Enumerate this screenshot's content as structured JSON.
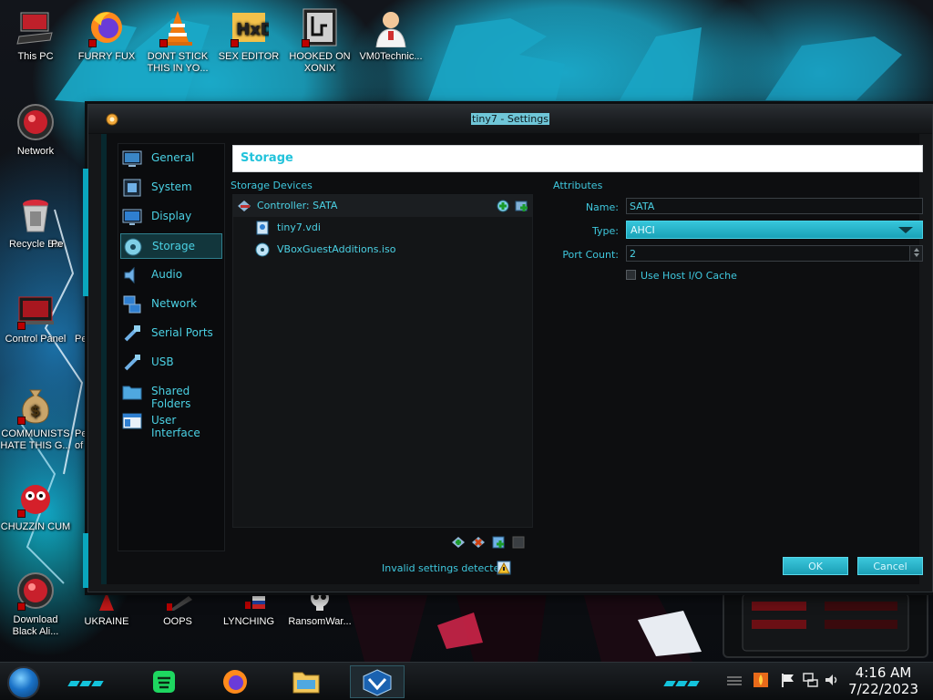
{
  "desktop": {
    "icons": [
      {
        "label": "This PC",
        "icon": "computer-icon"
      },
      {
        "label": "FURRY FUX",
        "icon": "firefox-icon"
      },
      {
        "label": "DONT STICK THIS IN YO...",
        "icon": "vlc-cone-icon"
      },
      {
        "label": "SEX EDITOR",
        "icon": "hxd-icon"
      },
      {
        "label": "HOOKED ON XONIX",
        "icon": "xonix-game-icon"
      },
      {
        "label": "VM0Technic...",
        "icon": "doctor-icon"
      },
      {
        "label": "Network",
        "icon": "network-orb-icon"
      },
      {
        "label": "Recycle Bin",
        "icon": "recycle-bin-icon"
      },
      {
        "label": "Pe",
        "icon": "partial-icon"
      },
      {
        "label": "Control Panel",
        "icon": "control-panel-icon"
      },
      {
        "label": "Pe",
        "icon": "partial-icon"
      },
      {
        "label": "COMMUNISTS HATE THIS G...",
        "icon": "money-bag-icon"
      },
      {
        "label": "Pe of",
        "icon": "partial-icon"
      },
      {
        "label": "CHUZZIN CUM",
        "icon": "chuzzle-icon"
      },
      {
        "label": "Download Black Ali...",
        "icon": "download-orb-icon"
      },
      {
        "label": "UKRAINE",
        "icon": "ukraine-icon"
      },
      {
        "label": "OOPS",
        "icon": "oops-icon"
      },
      {
        "label": "LYNCHING",
        "icon": "lynching-icon"
      },
      {
        "label": "RansomWar...",
        "icon": "skull-icon"
      }
    ]
  },
  "dialog": {
    "title": "tiny7 - Settings",
    "page_title": "Storage",
    "nav": [
      {
        "label": "General",
        "icon": "general-icon"
      },
      {
        "label": "System",
        "icon": "system-icon"
      },
      {
        "label": "Display",
        "icon": "display-icon"
      },
      {
        "label": "Storage",
        "icon": "storage-icon",
        "selected": true
      },
      {
        "label": "Audio",
        "icon": "audio-icon"
      },
      {
        "label": "Network",
        "icon": "network-icon"
      },
      {
        "label": "Serial Ports",
        "icon": "serial-ports-icon"
      },
      {
        "label": "USB",
        "icon": "usb-icon"
      },
      {
        "label": "Shared Folders",
        "icon": "shared-folders-icon"
      },
      {
        "label": "User Interface",
        "icon": "user-interface-icon"
      }
    ],
    "storage_devices_label": "Storage Devices",
    "controller_label": "Controller: SATA",
    "devices": [
      {
        "label": "tiny7.vdi",
        "icon": "hard-disk-icon"
      },
      {
        "label": "VBoxGuestAdditions.iso",
        "icon": "optical-disc-icon"
      }
    ],
    "attributes": {
      "heading": "Attributes",
      "name_label": "Name:",
      "name_value": "SATA",
      "type_label": "Type:",
      "type_value": "AHCI",
      "port_count_label": "Port Count:",
      "port_count_value": "2",
      "host_cache_label": "Use Host I/O Cache",
      "host_cache_checked": false
    },
    "status_message": "Invalid settings detected",
    "ok_label": "OK",
    "cancel_label": "Cancel"
  },
  "taskbar": {
    "apps": [
      {
        "name": "spotify",
        "icon": "spotify-icon"
      },
      {
        "name": "firefox",
        "icon": "firefox-icon"
      },
      {
        "name": "explorer",
        "icon": "file-explorer-icon"
      },
      {
        "name": "virtualbox",
        "icon": "virtualbox-icon",
        "active": true
      }
    ],
    "tray": [
      "fire-icon",
      "flag-icon",
      "network-tray-icon",
      "volume-icon"
    ],
    "time": "4:16 AM",
    "date": "7/22/2023"
  },
  "colors": {
    "accent": "#3fc8de",
    "accent_bright": "#1aa9c8",
    "window_bg": "#151719"
  }
}
